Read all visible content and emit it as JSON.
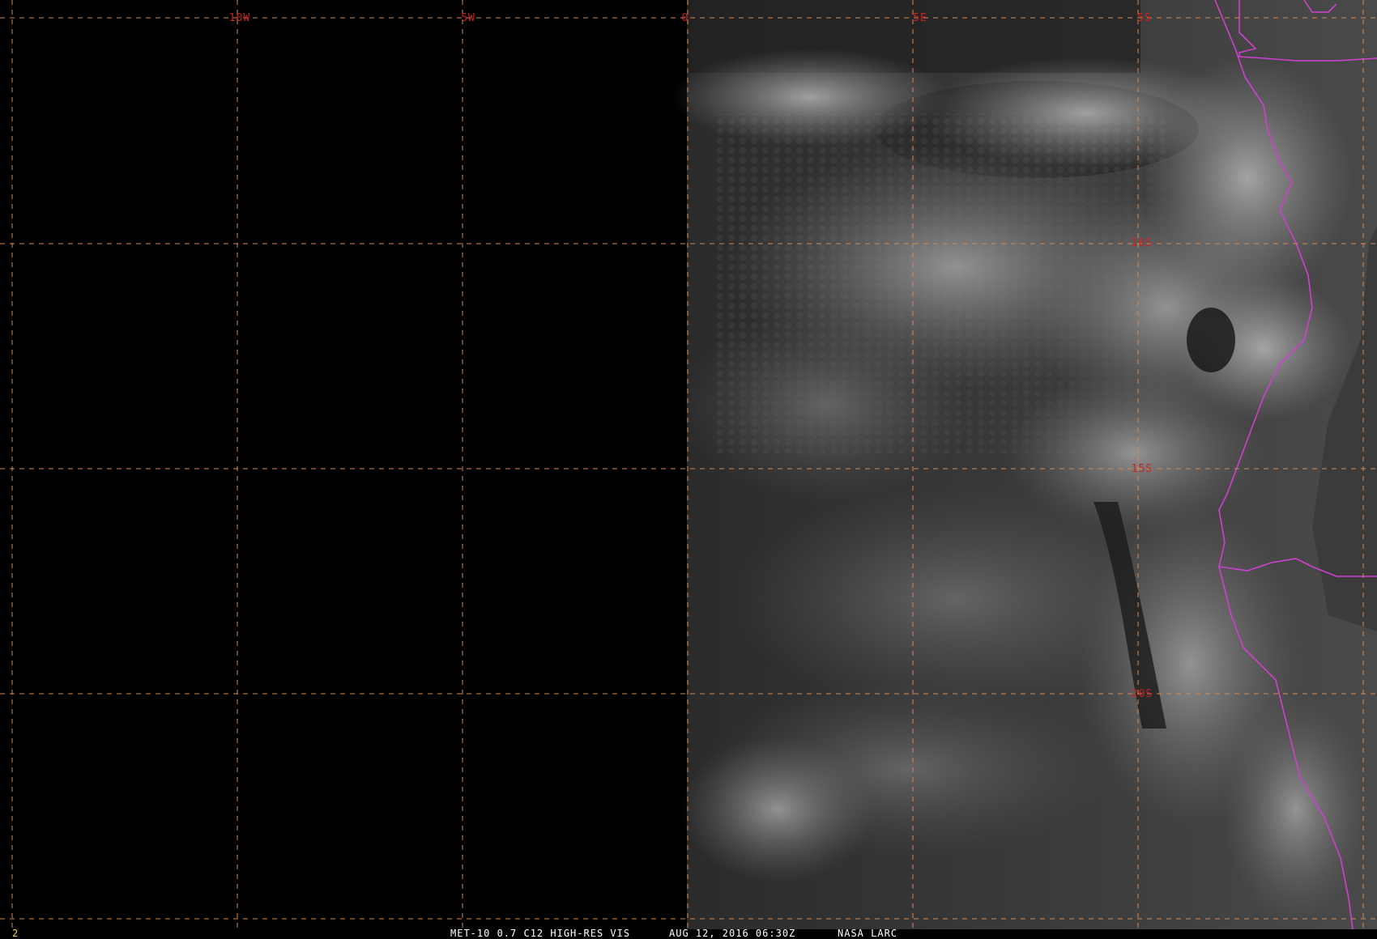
{
  "satellite_image": {
    "channel_label": "MET-10 0.7 C12 HIGH-RES VIS",
    "datetime_label": "AUG 12, 2016 06:30Z",
    "credit_label": "NASA LARC",
    "frame_number": "2"
  },
  "map": {
    "longitude_labels": [
      "10W",
      "5W",
      "0",
      "5E",
      "5S"
    ],
    "latitude_labels": [
      "10S",
      "15S",
      "20S"
    ]
  },
  "colors": {
    "background": "#000000",
    "grid_line": "#d28a55",
    "grid_label": "#cc2222",
    "border": "#d040d0",
    "cloud_light": "#9a9a9a",
    "cloud_dark": "#2a2a2a",
    "caption_text": "#ffffff",
    "frame_number": "#e8d23a"
  }
}
